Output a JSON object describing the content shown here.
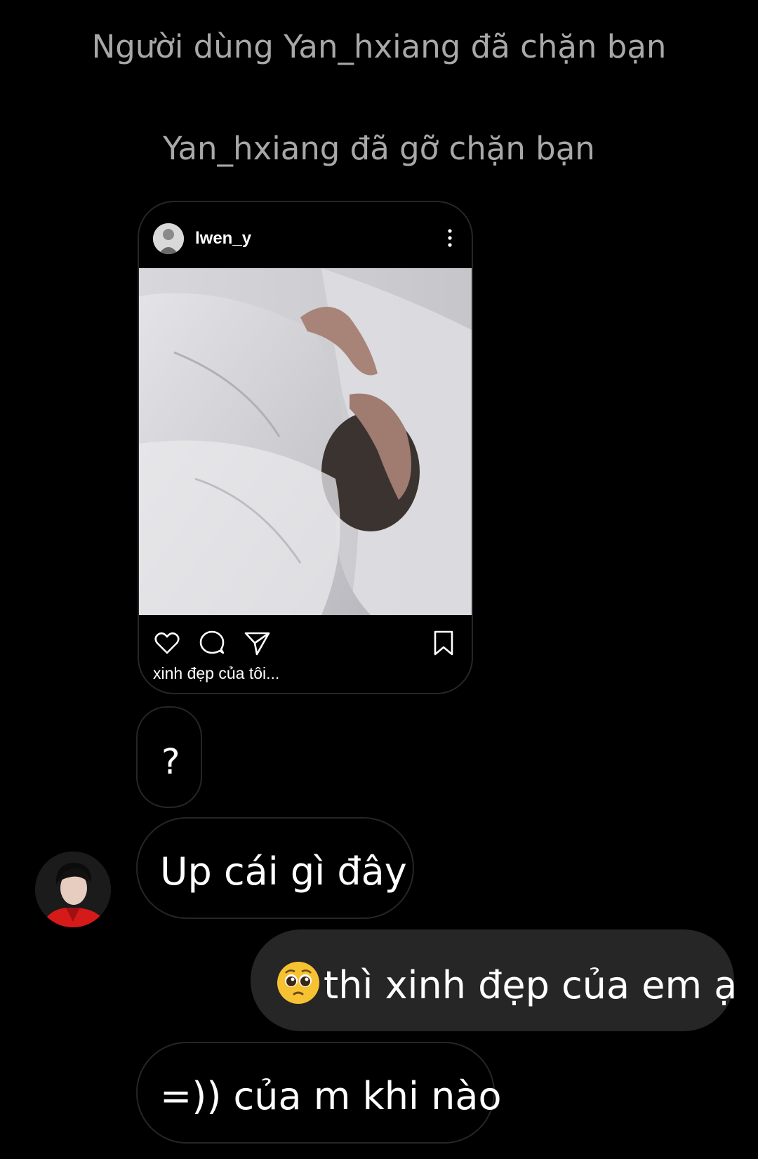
{
  "system_messages": {
    "blocked": "Người dùng Yan_hxiang đã chặn bạn",
    "unblocked": "Yan_hxiang đã gỡ chặn bạn"
  },
  "shared_post": {
    "username": "lwen_y",
    "caption": "xinh đẹp của tôi..."
  },
  "messages": [
    {
      "text": "?",
      "direction": "incoming"
    },
    {
      "text": "Up cái gì đây",
      "direction": "incoming"
    },
    {
      "text": "thì xinh đẹp của em ạ",
      "direction": "outgoing",
      "emoji": "pleading-face-emoji"
    },
    {
      "text": "=)) của m khi nào",
      "direction": "incoming"
    }
  ],
  "colors": {
    "background": "#000000",
    "system_text": "#a8a8a8",
    "incoming_border": "#262626",
    "outgoing_bg": "#262626",
    "text": "#ffffff"
  }
}
